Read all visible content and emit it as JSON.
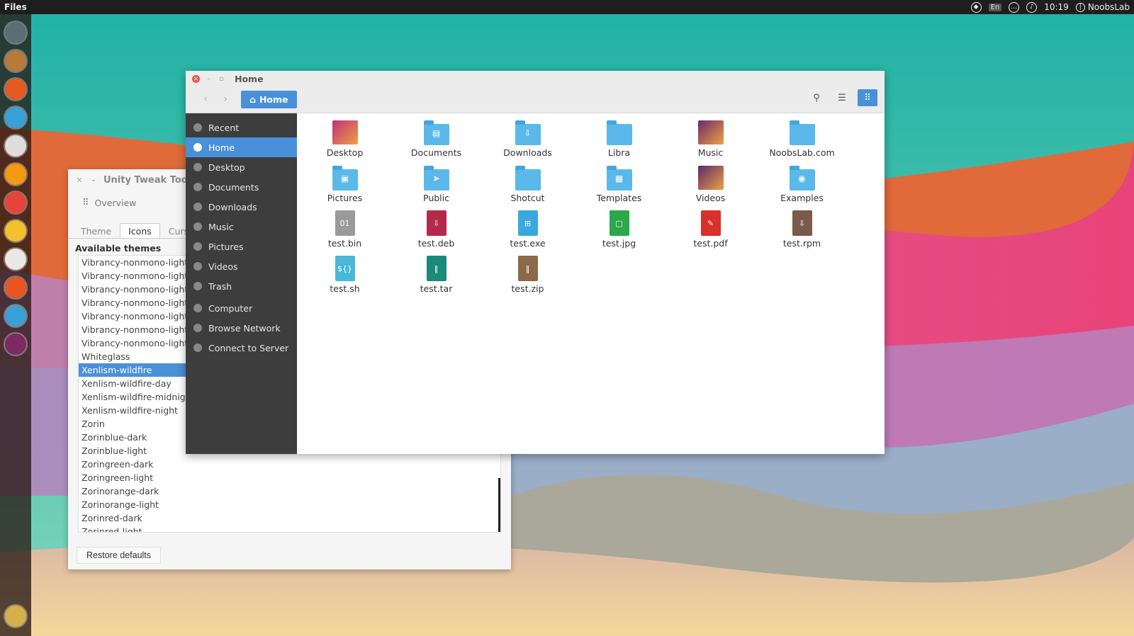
{
  "top_panel": {
    "app_name": "Files",
    "lang": "En",
    "time": "10:19",
    "user": "NoobsLab"
  },
  "launcher": {
    "items": [
      {
        "name": "dash-icon",
        "color": "#5a6e78"
      },
      {
        "name": "files-icon",
        "color": "#b87a3a"
      },
      {
        "name": "firefox-icon",
        "color": "#e55b1f"
      },
      {
        "name": "text-editor-icon",
        "color": "#39a0d8"
      },
      {
        "name": "settings-icon",
        "color": "#dddddd"
      },
      {
        "name": "software-icon",
        "color": "#f39a12"
      },
      {
        "name": "document-icon",
        "color": "#e6443a"
      },
      {
        "name": "sticky-icon",
        "color": "#f2c12e"
      },
      {
        "name": "calculator-icon",
        "color": "#e8e8e8"
      },
      {
        "name": "store-icon",
        "color": "#e95420"
      },
      {
        "name": "tweak-icon",
        "color": "#39a0d8"
      },
      {
        "name": "gear-icon",
        "color": "#7c2a63"
      }
    ],
    "bottom": {
      "name": "trash-icon",
      "color": "#d4b04a"
    }
  },
  "tweak_window": {
    "title": "Unity Tweak Tool",
    "overview": "Overview",
    "tabs": [
      "Theme",
      "Icons",
      "Curs"
    ],
    "active_tab": 1,
    "heading": "Available themes",
    "themes": [
      "Vibrancy-nonmono-light-gr",
      "Vibrancy-nonmono-light-o",
      "Vibrancy-nonmono-light-pi",
      "Vibrancy-nonmono-light-pi",
      "Vibrancy-nonmono-light-re",
      "Vibrancy-nonmono-light-te",
      "Vibrancy-nonmono-light-ye",
      "Whiteglass",
      "Xenlism-wildfire",
      "Xenlism-wildfire-day",
      "Xenlism-wildfire-midnight",
      "Xenlism-wildfire-night",
      "Zorin",
      "Zorinblue-dark",
      "Zorinblue-light",
      "Zoringreen-dark",
      "Zoringreen-light",
      "Zorinorange-dark",
      "Zorinorange-light",
      "Zorinred-dark",
      "Zorinred-light"
    ],
    "selected_index": 8,
    "restore": "Restore defaults"
  },
  "files_window": {
    "title": "Home",
    "path_button": "Home",
    "sidebar": [
      {
        "label": "Recent",
        "icon": "clock-icon"
      },
      {
        "label": "Home",
        "icon": "home-icon",
        "active": true
      },
      {
        "label": "Desktop",
        "icon": "desktop-icon"
      },
      {
        "label": "Documents",
        "icon": "documents-icon"
      },
      {
        "label": "Downloads",
        "icon": "download-icon"
      },
      {
        "label": "Music",
        "icon": "music-icon"
      },
      {
        "label": "Pictures",
        "icon": "camera-icon"
      },
      {
        "label": "Videos",
        "icon": "film-icon"
      },
      {
        "label": "Trash",
        "icon": "trash-icon"
      },
      {
        "label": "Computer",
        "icon": "computer-icon"
      },
      {
        "label": "Browse Network",
        "icon": "network-icon"
      },
      {
        "label": "Connect to Server",
        "icon": "server-icon"
      }
    ],
    "files": [
      {
        "label": "Desktop",
        "kind": "picture",
        "color": "#c0307a"
      },
      {
        "label": "Documents",
        "kind": "folder",
        "emblem": "▤"
      },
      {
        "label": "Downloads",
        "kind": "folder",
        "emblem": "⇩"
      },
      {
        "label": "Libra",
        "kind": "folder",
        "emblem": ""
      },
      {
        "label": "Music",
        "kind": "picture",
        "color": "#6a2a6e"
      },
      {
        "label": "NoobsLab.com",
        "kind": "folder",
        "emblem": ""
      },
      {
        "label": "Pictures",
        "kind": "folder",
        "emblem": "▣"
      },
      {
        "label": "Public",
        "kind": "folder",
        "emblem": "➤"
      },
      {
        "label": "Shotcut",
        "kind": "folder",
        "emblem": ""
      },
      {
        "label": "Templates",
        "kind": "folder",
        "emblem": "▦"
      },
      {
        "label": "Videos",
        "kind": "picture",
        "color": "#5a2a6e"
      },
      {
        "label": "Examples",
        "kind": "folder",
        "emblem": "◉"
      },
      {
        "label": "test.bin",
        "kind": "doc",
        "color": "#9a9a9a",
        "emblem": "01"
      },
      {
        "label": "test.deb",
        "kind": "doc",
        "color": "#b42a4a",
        "emblem": "⇩"
      },
      {
        "label": "test.exe",
        "kind": "doc",
        "color": "#3aa8e0",
        "emblem": "⊞"
      },
      {
        "label": "test.jpg",
        "kind": "doc",
        "color": "#2aa84a",
        "emblem": "▢"
      },
      {
        "label": "test.pdf",
        "kind": "doc",
        "color": "#d8302a",
        "emblem": "✎"
      },
      {
        "label": "test.rpm",
        "kind": "doc",
        "color": "#7a5a4a",
        "emblem": "⇩"
      },
      {
        "label": "test.sh",
        "kind": "doc",
        "color": "#4ab8d8",
        "emblem": "${}"
      },
      {
        "label": "test.tar",
        "kind": "doc",
        "color": "#1a8a7a",
        "emblem": "‖"
      },
      {
        "label": "test.zip",
        "kind": "doc",
        "color": "#8a6a4a",
        "emblem": "‖"
      }
    ]
  }
}
